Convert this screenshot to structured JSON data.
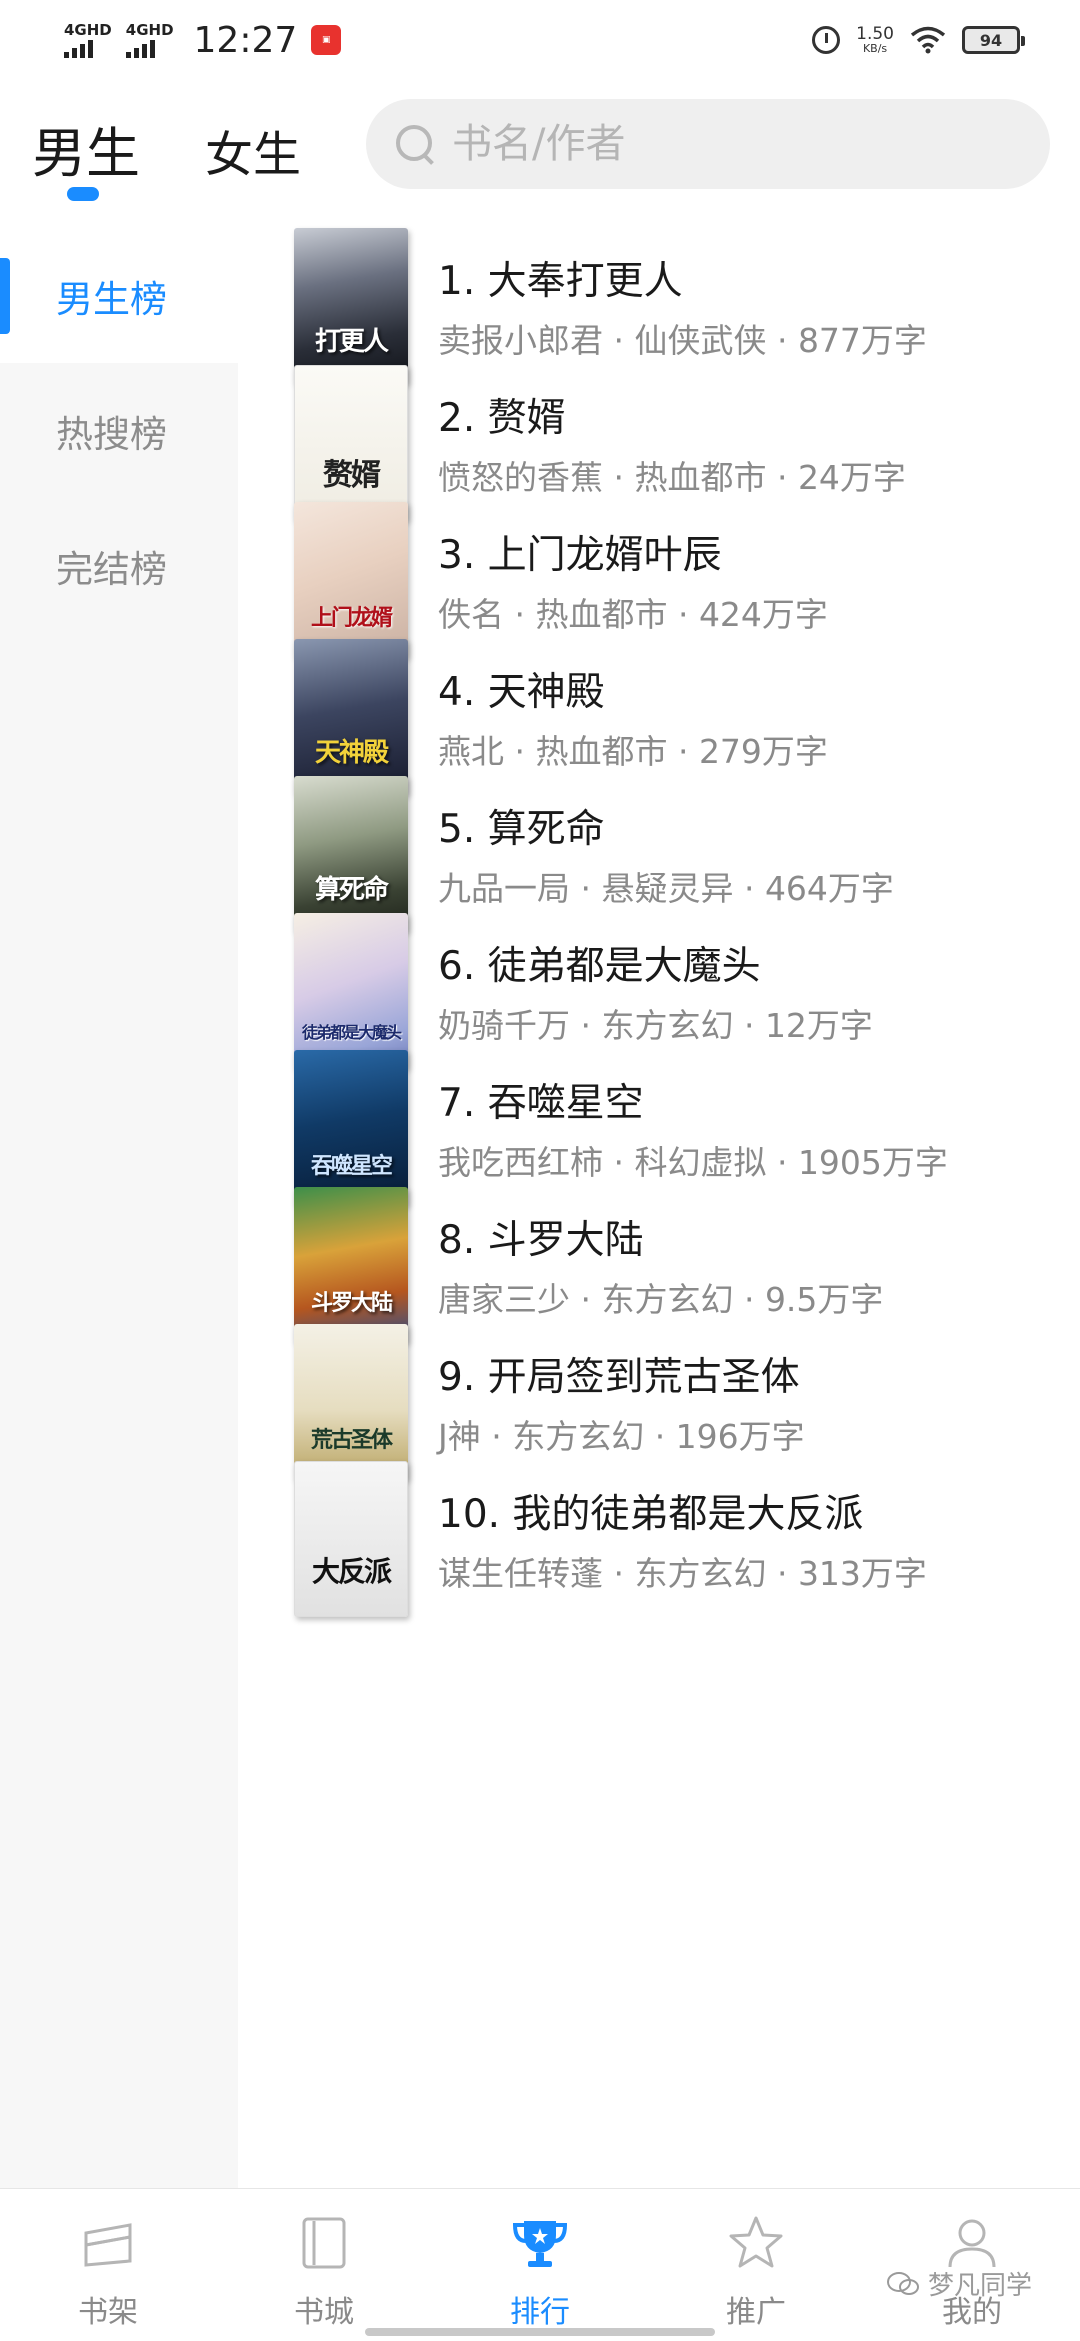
{
  "status_bar": {
    "network1": "4GHD",
    "network2": "4GHD",
    "time": "12:27",
    "speed_value": "1.50",
    "speed_unit": "KB/s",
    "battery": "94"
  },
  "header": {
    "tabs": [
      {
        "label": "男生",
        "active": true
      },
      {
        "label": "女生",
        "active": false
      }
    ],
    "search_placeholder": "书名/作者"
  },
  "sidebar": {
    "items": [
      {
        "label": "男生榜",
        "active": true
      },
      {
        "label": "热搜榜",
        "active": false
      },
      {
        "label": "完结榜",
        "active": false
      }
    ]
  },
  "books": [
    {
      "title": "1. 大奉打更人",
      "meta": "卖报小郎君 · 仙侠武侠 · 877万字",
      "cover_text": "打更人"
    },
    {
      "title": "2. 赘婿",
      "meta": "愤怒的香蕉 · 热血都市 · 24万字",
      "cover_text": "赘婿"
    },
    {
      "title": "3. 上门龙婿叶辰",
      "meta": "佚名 · 热血都市 · 424万字",
      "cover_text": "上门龙婿"
    },
    {
      "title": "4. 天神殿",
      "meta": "燕北 · 热血都市 · 279万字",
      "cover_text": "天神殿"
    },
    {
      "title": "5. 算死命",
      "meta": "九品一局 · 悬疑灵异 · 464万字",
      "cover_text": "算死命"
    },
    {
      "title": "6. 徒弟都是大魔头",
      "meta": "奶骑千万 · 东方玄幻 · 12万字",
      "cover_text": "徒弟都是大魔头"
    },
    {
      "title": "7. 吞噬星空",
      "meta": "我吃西红柿 · 科幻虚拟 · 1905万字",
      "cover_text": "吞噬星空"
    },
    {
      "title": "8. 斗罗大陆",
      "meta": "唐家三少 · 东方玄幻 · 9.5万字",
      "cover_text": "斗罗大陆"
    },
    {
      "title": "9. 开局签到荒古圣体",
      "meta": "J神 · 东方玄幻 · 196万字",
      "cover_text": "荒古圣体"
    },
    {
      "title": "10. 我的徒弟都是大反派",
      "meta": "谋生任转蓬 · 东方玄幻 · 313万字",
      "cover_text": "大反派"
    }
  ],
  "bottom_nav": [
    {
      "label": "书架",
      "icon": "bookshelf-icon",
      "active": false
    },
    {
      "label": "书城",
      "icon": "bookstore-icon",
      "active": false
    },
    {
      "label": "排行",
      "icon": "trophy-icon",
      "active": true
    },
    {
      "label": "推广",
      "icon": "star-icon",
      "active": false
    },
    {
      "label": "我的",
      "icon": "profile-icon",
      "active": false
    }
  ],
  "watermark": "梦凡同学",
  "colors": {
    "accent": "#1a8cff",
    "text_primary": "#1a1a1a",
    "text_secondary": "#8a8a8a",
    "sidebar_bg": "#f7f7f7"
  }
}
